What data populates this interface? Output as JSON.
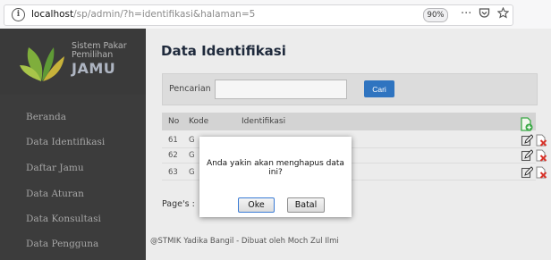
{
  "browser": {
    "url_host": "localhost",
    "url_path": "/sp/admin/?h=identifikasi&halaman=5",
    "zoom": "90%",
    "menu_icon": "···"
  },
  "sidebar": {
    "logo": {
      "title_line1": "Sistem Pakar",
      "title_line2": "Pemilihan",
      "brand": "JAMU"
    },
    "items": [
      {
        "label": "Beranda"
      },
      {
        "label": "Data Identifikasi"
      },
      {
        "label": "Daftar Jamu"
      },
      {
        "label": "Data Aturan"
      },
      {
        "label": "Data Konsultasi"
      },
      {
        "label": "Data Pengguna"
      }
    ]
  },
  "main": {
    "title": "Data Identifikasi",
    "search": {
      "label": "Pencarian",
      "value": "",
      "button": "Cari"
    },
    "table": {
      "headers": [
        "No",
        "Kode",
        "Identifikasi"
      ],
      "rows": [
        {
          "no": "61",
          "kode": "G"
        },
        {
          "no": "62",
          "kode": "G"
        },
        {
          "no": "63",
          "kode": "G"
        }
      ]
    },
    "pages_label": "Page's :",
    "footer": "@STMIK Yadika Bangil - Dibuat oleh Moch Zul Ilmi"
  },
  "dialog": {
    "message": "Anda yakin akan menghapus data ini?",
    "ok_label": "Oke",
    "cancel_label": "Batal"
  },
  "colors": {
    "sidebar_bg": "#3c3c3c",
    "content_bg": "#ececec",
    "accent": "#2f74c0",
    "add_icon": "#3aa845",
    "delete_icon": "#d8332a"
  },
  "icons": {
    "add": "add-document-icon",
    "edit": "edit-pencil-icon",
    "delete": "delete-x-icon"
  }
}
